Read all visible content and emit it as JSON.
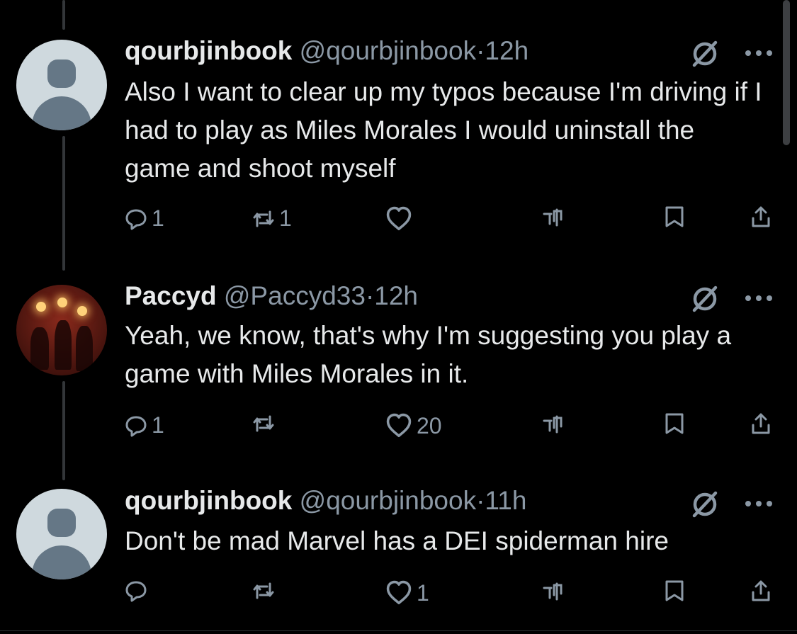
{
  "tweets": [
    {
      "name": "qourbjinbook",
      "handle": "@qourbjinbook",
      "separator": "·",
      "time": "12h",
      "text": "Also I want to clear up my typos because I'm driving if I had to play as Miles Morales I would uninstall the game and shoot myself",
      "replies": "1",
      "reposts": "1",
      "likes": ""
    },
    {
      "name": "Paccyd",
      "handle": "@Paccyd33",
      "separator": "·",
      "time": "12h",
      "text": "Yeah, we know, that's why I'm suggesting you play a game with Miles Morales in it.",
      "replies": "1",
      "reposts": "",
      "likes": "20"
    },
    {
      "name": "qourbjinbook",
      "handle": "@qourbjinbook",
      "separator": "·",
      "time": "11h",
      "text": "Don't be mad Marvel has a DEI spiderman hire",
      "replies": "",
      "reposts": "",
      "likes": "1"
    }
  ],
  "colors": {
    "background": "#000000",
    "text_primary": "#e7e9ea",
    "text_secondary": "#8b98a5",
    "thread_line": "#333639"
  },
  "icons": {
    "reply": "reply-icon",
    "repost": "repost-icon",
    "like": "heart-icon",
    "views": "views-icon",
    "bookmark": "bookmark-icon",
    "share": "share-icon",
    "grok": "grok-icon",
    "more": "more-icon"
  }
}
